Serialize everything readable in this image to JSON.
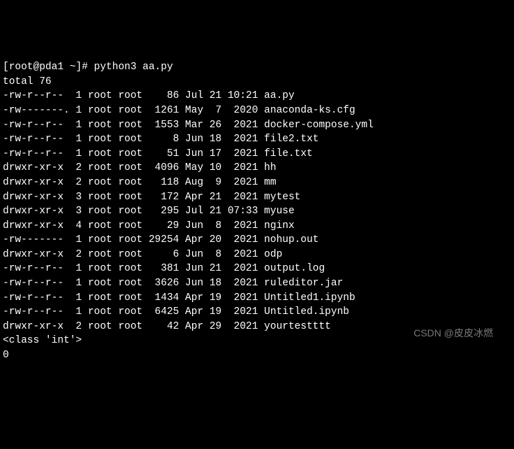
{
  "prompt": "[root@pda1 ~]# python3 aa.py",
  "total_line": "total 76",
  "rows": [
    {
      "perm": "-rw-r--r-- ",
      "links": "1",
      "owner": "root",
      "group": "root",
      "size": "86",
      "month": "Jul",
      "day": "21",
      "time": "10:21",
      "name": "aa.py"
    },
    {
      "perm": "-rw-------.",
      "links": "1",
      "owner": "root",
      "group": "root",
      "size": "1261",
      "month": "May",
      "day": " 7",
      "time": " 2020",
      "name": "anaconda-ks.cfg"
    },
    {
      "perm": "-rw-r--r-- ",
      "links": "1",
      "owner": "root",
      "group": "root",
      "size": "1553",
      "month": "Mar",
      "day": "26",
      "time": " 2021",
      "name": "docker-compose.yml"
    },
    {
      "perm": "-rw-r--r-- ",
      "links": "1",
      "owner": "root",
      "group": "root",
      "size": "8",
      "month": "Jun",
      "day": "18",
      "time": " 2021",
      "name": "file2.txt"
    },
    {
      "perm": "-rw-r--r-- ",
      "links": "1",
      "owner": "root",
      "group": "root",
      "size": "51",
      "month": "Jun",
      "day": "17",
      "time": " 2021",
      "name": "file.txt"
    },
    {
      "perm": "drwxr-xr-x ",
      "links": "2",
      "owner": "root",
      "group": "root",
      "size": "4096",
      "month": "May",
      "day": "10",
      "time": " 2021",
      "name": "hh"
    },
    {
      "perm": "drwxr-xr-x ",
      "links": "2",
      "owner": "root",
      "group": "root",
      "size": "118",
      "month": "Aug",
      "day": " 9",
      "time": " 2021",
      "name": "mm"
    },
    {
      "perm": "drwxr-xr-x ",
      "links": "3",
      "owner": "root",
      "group": "root",
      "size": "172",
      "month": "Apr",
      "day": "21",
      "time": " 2021",
      "name": "mytest"
    },
    {
      "perm": "drwxr-xr-x ",
      "links": "3",
      "owner": "root",
      "group": "root",
      "size": "295",
      "month": "Jul",
      "day": "21",
      "time": "07:33",
      "name": "myuse"
    },
    {
      "perm": "drwxr-xr-x ",
      "links": "4",
      "owner": "root",
      "group": "root",
      "size": "29",
      "month": "Jun",
      "day": " 8",
      "time": " 2021",
      "name": "nginx"
    },
    {
      "perm": "-rw------- ",
      "links": "1",
      "owner": "root",
      "group": "root",
      "size": "29254",
      "month": "Apr",
      "day": "20",
      "time": " 2021",
      "name": "nohup.out"
    },
    {
      "perm": "drwxr-xr-x ",
      "links": "2",
      "owner": "root",
      "group": "root",
      "size": "6",
      "month": "Jun",
      "day": " 8",
      "time": " 2021",
      "name": "odp"
    },
    {
      "perm": "-rw-r--r-- ",
      "links": "1",
      "owner": "root",
      "group": "root",
      "size": "381",
      "month": "Jun",
      "day": "21",
      "time": " 2021",
      "name": "output.log"
    },
    {
      "perm": "-rw-r--r-- ",
      "links": "1",
      "owner": "root",
      "group": "root",
      "size": "3626",
      "month": "Jun",
      "day": "18",
      "time": " 2021",
      "name": "ruleditor.jar"
    },
    {
      "perm": "-rw-r--r-- ",
      "links": "1",
      "owner": "root",
      "group": "root",
      "size": "1434",
      "month": "Apr",
      "day": "19",
      "time": " 2021",
      "name": "Untitled1.ipynb"
    },
    {
      "perm": "-rw-r--r-- ",
      "links": "1",
      "owner": "root",
      "group": "root",
      "size": "6425",
      "month": "Apr",
      "day": "19",
      "time": " 2021",
      "name": "Untitled.ipynb"
    },
    {
      "perm": "drwxr-xr-x ",
      "links": "2",
      "owner": "root",
      "group": "root",
      "size": "42",
      "month": "Apr",
      "day": "29",
      "time": " 2021",
      "name": "yourtestttt"
    }
  ],
  "class_line": "<class 'int'>",
  "zero_line": "0",
  "watermark": "CSDN @皮皮冰燃"
}
